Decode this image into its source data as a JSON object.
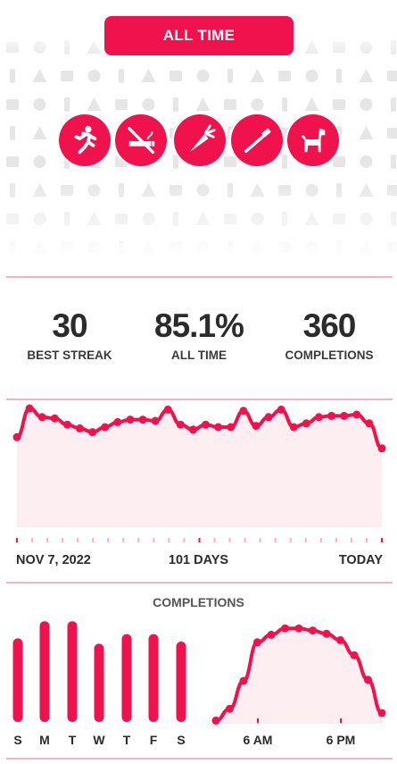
{
  "period_button": "ALL TIME",
  "habits": [
    {
      "name": "running-icon"
    },
    {
      "name": "no-smoking-icon"
    },
    {
      "name": "carrot-icon"
    },
    {
      "name": "toothbrush-icon"
    },
    {
      "name": "dog-icon"
    }
  ],
  "stats": {
    "best_streak": {
      "value": "30",
      "label": "BEST STREAK"
    },
    "all_time": {
      "value": "85.1%",
      "label": "ALL TIME"
    },
    "completions": {
      "value": "360",
      "label": "COMPLETIONS"
    }
  },
  "trend": {
    "start_label": "NOV 7, 2022",
    "span_label": "101 DAYS",
    "end_label": "TODAY"
  },
  "completions_title": "COMPLETIONS",
  "colors": {
    "accent": "#f0124d",
    "fill": "#fdeef2",
    "divider": "#f4b3c4"
  },
  "chart_data": [
    {
      "type": "area",
      "x": [
        1,
        2,
        3,
        4,
        5,
        6,
        7,
        8,
        9,
        10,
        11,
        12,
        13,
        14,
        15,
        16,
        17,
        18,
        19,
        20,
        21,
        22,
        23,
        24,
        25,
        26,
        27,
        28,
        29,
        30
      ],
      "values": [
        72,
        95,
        88,
        87,
        82,
        79,
        76,
        80,
        84,
        86,
        86,
        85,
        94,
        82,
        78,
        82,
        80,
        80,
        93,
        81,
        88,
        94,
        80,
        83,
        88,
        89,
        89,
        90,
        83,
        63
      ],
      "ylim": [
        0,
        100
      ]
    },
    {
      "type": "bar",
      "categories": [
        "S",
        "M",
        "T",
        "W",
        "T",
        "F",
        "S"
      ],
      "values": [
        78,
        94,
        94,
        73,
        82,
        82,
        75
      ],
      "ylim": [
        0,
        100
      ]
    },
    {
      "type": "area",
      "categories": [
        "6 AM",
        "6 PM"
      ],
      "values": [
        3,
        14,
        40,
        76,
        83,
        89,
        89,
        87,
        84,
        78,
        64,
        41,
        10
      ],
      "ylim": [
        0,
        100
      ]
    }
  ]
}
